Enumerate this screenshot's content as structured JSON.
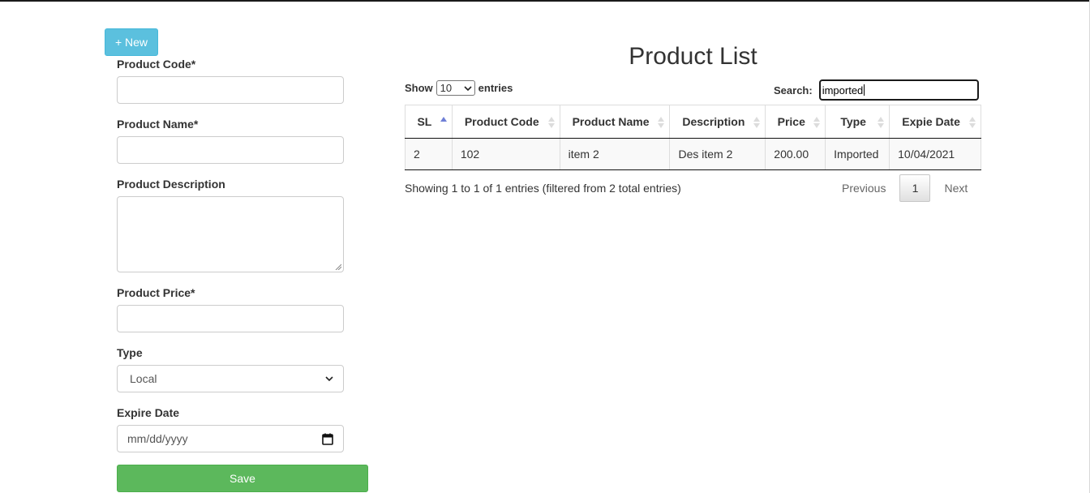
{
  "toolbar": {
    "new_label": "+ New"
  },
  "form": {
    "product_code": {
      "label": "Product Code*",
      "value": ""
    },
    "product_name": {
      "label": "Product Name*",
      "value": ""
    },
    "product_description": {
      "label": "Product Description",
      "value": ""
    },
    "product_price": {
      "label": "Product Price*",
      "value": ""
    },
    "type": {
      "label": "Type",
      "selected": "Local"
    },
    "expire_date": {
      "label": "Expire Date",
      "placeholder": "mm/dd/yyyy"
    },
    "save_label": "Save"
  },
  "list": {
    "title": "Product List",
    "show_label": "Show",
    "entries_label": "entries",
    "page_length": "10",
    "search_label": "Search:",
    "search_value": "imported",
    "columns": [
      "SL",
      "Product Code",
      "Product Name",
      "Description",
      "Price",
      "Type",
      "Expie Date"
    ],
    "rows": [
      [
        "2",
        "102",
        "item 2",
        "Des item 2",
        "200.00",
        "Imported",
        "10/04/2021"
      ]
    ],
    "info": "Showing 1 to 1 of 1 entries (filtered from 2 total entries)",
    "pager": {
      "previous": "Previous",
      "current": "1",
      "next": "Next"
    }
  },
  "colors": {
    "new_button": "#5bc0de",
    "save_button": "#5cb85c",
    "sort_active": "#6f7fd6"
  }
}
